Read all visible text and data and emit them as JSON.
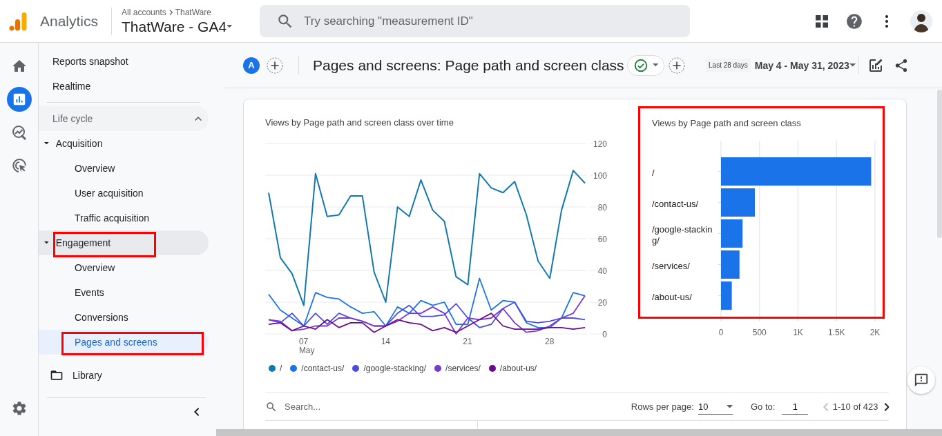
{
  "header": {
    "product": "Analytics",
    "breadcrumb": [
      "All accounts",
      "ThatWare"
    ],
    "property": "ThatWare - GA4",
    "search": {
      "placeholder": "Try searching \"measurement ID\""
    }
  },
  "rail": [
    {
      "kind": "home",
      "selected": false
    },
    {
      "kind": "reports",
      "selected": true
    },
    {
      "kind": "explore",
      "selected": false
    },
    {
      "kind": "advertising",
      "selected": false
    },
    {
      "kind": "admin",
      "selected": false
    }
  ],
  "sidebar": {
    "items": [
      {
        "kind": "link",
        "label": "Reports snapshot",
        "selected": false
      },
      {
        "kind": "link",
        "label": "Realtime",
        "selected": false
      },
      {
        "kind": "section",
        "label": "Life cycle",
        "expanded": true,
        "children": [
          {
            "kind": "group",
            "label": "Acquisition",
            "expanded": true,
            "highlighted": false,
            "children": [
              {
                "label": "Overview",
                "selected": false,
                "highlighted": false
              },
              {
                "label": "User acquisition",
                "selected": false,
                "highlighted": false
              },
              {
                "label": "Traffic acquisition",
                "selected": false,
                "highlighted": false
              }
            ]
          },
          {
            "kind": "group",
            "label": "Engagement",
            "expanded": true,
            "highlighted": true,
            "children": [
              {
                "label": "Overview",
                "selected": false,
                "highlighted": false
              },
              {
                "label": "Events",
                "selected": false,
                "highlighted": false
              },
              {
                "label": "Conversions",
                "selected": false,
                "highlighted": false
              },
              {
                "label": "Pages and screens",
                "selected": true,
                "highlighted": true
              }
            ]
          }
        ]
      },
      {
        "kind": "library",
        "label": "Library"
      }
    ]
  },
  "report": {
    "comparison": "A",
    "title": "Pages and screens: Page path and screen class",
    "date_preset": "Last 28 days",
    "date_range": "May 4 - May 31, 2023",
    "charts": [
      {
        "highlighted": false,
        "chart_data": {
          "type": "line",
          "title": "Views by Page path and screen class over time",
          "x": [
            4,
            5,
            6,
            7,
            8,
            9,
            10,
            11,
            12,
            13,
            14,
            15,
            16,
            17,
            18,
            19,
            20,
            21,
            22,
            23,
            24,
            25,
            26,
            27,
            28,
            29,
            30,
            31
          ],
          "xlim": [
            4,
            31
          ],
          "xticks": [
            {
              "value": 7,
              "label": "07"
            },
            {
              "value": 14,
              "label": "14"
            },
            {
              "value": 21,
              "label": "21"
            },
            {
              "value": 28,
              "label": "28"
            }
          ],
          "annotations": [
            "May"
          ],
          "ylim": [
            0,
            120
          ],
          "yticks": [
            0,
            20,
            40,
            60,
            80,
            100,
            120
          ],
          "grid": true,
          "legend": true,
          "series": [
            {
              "name": "/",
              "color": "#1179b0",
              "values": [
                89,
                48,
                38,
                18,
                101,
                74,
                75,
                87,
                87,
                39,
                20,
                80,
                74,
                97,
                78,
                71,
                36,
                31,
                101,
                92,
                89,
                96,
                75,
                46,
                35,
                78,
                103,
                95
              ]
            },
            {
              "name": "/contact-us/",
              "color": "#1a73e8",
              "values": [
                25,
                15,
                10,
                5,
                26,
                23,
                22,
                17,
                13,
                14,
                5,
                17,
                13,
                21,
                18,
                20,
                6,
                6,
                35,
                15,
                21,
                20,
                7,
                4,
                4,
                10,
                26,
                24
              ]
            },
            {
              "name": "/google-stacking/",
              "color": "#4b4be6",
              "values": [
                9,
                7,
                13,
                5,
                13,
                6,
                13,
                10,
                8,
                5,
                5,
                13,
                18,
                11,
                11,
                12,
                19,
                10,
                4,
                6,
                16,
                20,
                8,
                7,
                8,
                10,
                10,
                9
              ]
            },
            {
              "name": "/services/",
              "color": "#7b37d4",
              "values": [
                9,
                8,
                2,
                3,
                5,
                5,
                10,
                10,
                8,
                5,
                5,
                8,
                13,
                13,
                17,
                13,
                0,
                10,
                9,
                10,
                16,
                7,
                1,
                2,
                5,
                10,
                13,
                24
              ]
            },
            {
              "name": "/about-us/",
              "color": "#6a0b8f",
              "values": [
                6,
                7,
                2,
                5,
                3,
                9,
                4,
                7,
                7,
                1,
                5,
                9,
                7,
                6,
                2,
                4,
                1,
                5,
                9,
                13,
                5,
                3,
                3,
                3,
                4,
                4,
                3,
                4
              ]
            }
          ]
        }
      },
      {
        "highlighted": true,
        "chart_data": {
          "type": "bar",
          "orientation": "horizontal",
          "title": "Views by Page path and screen class",
          "categories": [
            "/",
            "/contact-us/",
            "/google-stacking/",
            "/services/",
            "/about-us/"
          ],
          "values": [
            1950,
            440,
            280,
            240,
            140
          ],
          "xlim": [
            0,
            2000
          ],
          "grid": true,
          "xticks": [
            {
              "value": 0,
              "label": "0"
            },
            {
              "value": 500,
              "label": "500"
            },
            {
              "value": 1000,
              "label": "1K"
            },
            {
              "value": 1500,
              "label": "1.5K"
            },
            {
              "value": 2000,
              "label": "2K"
            }
          ]
        }
      }
    ]
  },
  "table": {
    "search": {
      "placeholder": "Search..."
    },
    "rows_per_page": {
      "label": "Rows per page:",
      "value": "10"
    },
    "go_to": {
      "label": "Go to:",
      "value": "1"
    },
    "range": "1-10 of 423",
    "prev_disabled": true,
    "next_disabled": false
  }
}
